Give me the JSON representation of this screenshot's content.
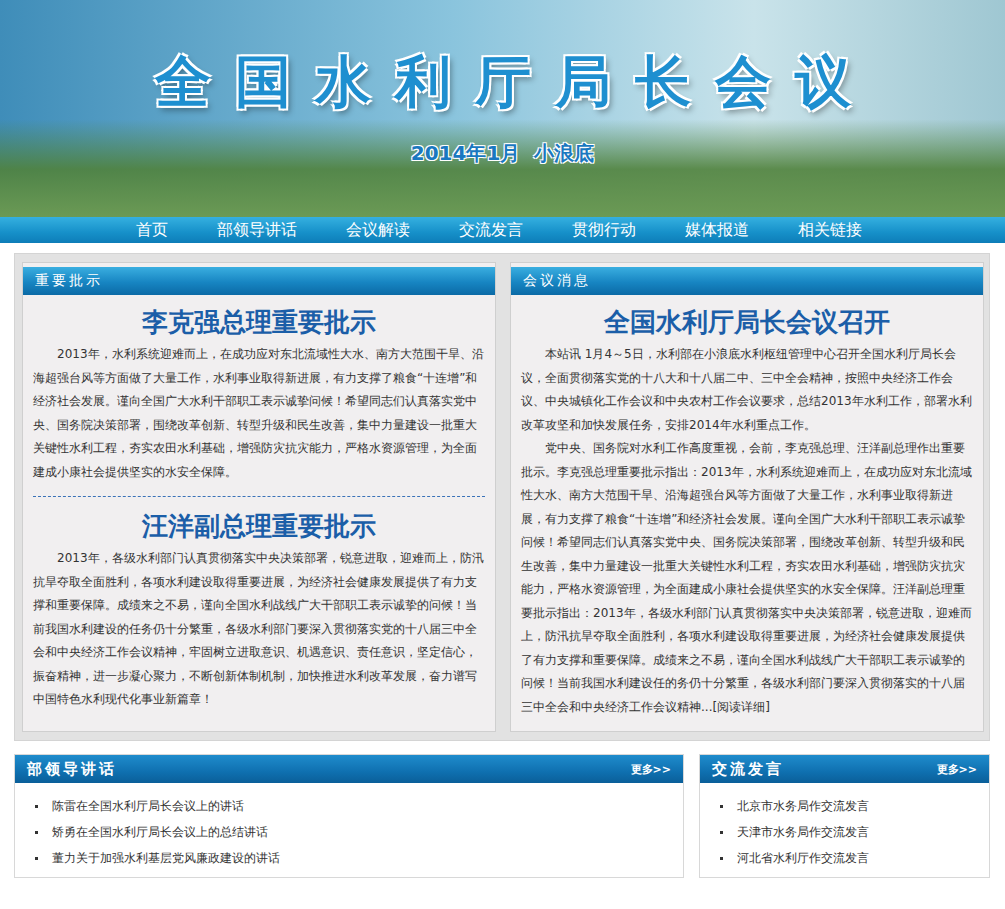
{
  "banner": {
    "title": "全国水利厅局长会议",
    "subtitle": "2014年1月  小浪底"
  },
  "nav": [
    "首页",
    "部领导讲话",
    "会议解读",
    "交流发言",
    "贯彻行动",
    "媒体报道",
    "相关链接"
  ],
  "instructions_panel": {
    "header": "重要批示",
    "items": [
      {
        "title": "李克强总理重要批示",
        "body": "2013年，水利系统迎难而上，在成功应对东北流域性大水、南方大范围干旱、沿海超强台风等方面做了大量工作，水利事业取得新进展，有力支撑了粮食“十连增”和经济社会发展。谨向全国广大水利干部职工表示诚挚问候！希望同志们认真落实党中央、国务院决策部署，围绕改革创新、转型升级和民生改善，集中力量建设一批重大关键性水利工程，夯实农田水利基础，增强防灾抗灾能力，严格水资源管理，为全面建成小康社会提供坚实的水安全保障。"
      },
      {
        "title": "汪洋副总理重要批示",
        "body": "2013年，各级水利部门认真贯彻落实中央决策部署，锐意进取，迎难而上，防汛抗旱夺取全面胜利，各项水利建设取得重要进展，为经济社会健康发展提供了有力支撑和重要保障。成绩来之不易，谨向全国水利战线广大干部职工表示诚挚的问候！当前我国水利建设的任务仍十分繁重，各级水利部门要深入贯彻落实党的十八届三中全会和中央经济工作会议精神，牢固树立进取意识、机遇意识、责任意识，坚定信心，振奋精神，进一步凝心聚力，不断创新体制机制，加快推进水利改革发展，奋力谱写中国特色水利现代化事业新篇章！"
      }
    ]
  },
  "news_panel": {
    "header": "会议消息",
    "title": "全国水利厅局长会议召开",
    "paragraphs": [
      "本站讯  1月4～5日，水利部在小浪底水利枢纽管理中心召开全国水利厅局长会议，全面贯彻落实党的十八大和十八届二中、三中全会精神，按照中央经济工作会议、中央城镇化工作会议和中央农村工作会议要求，总结2013年水利工作，部署水利改革攻坚和加快发展任务，安排2014年水利重点工作。",
      "党中央、国务院对水利工作高度重视，会前，李克强总理、汪洋副总理作出重要批示。李克强总理重要批示指出：2013年，水利系统迎难而上，在成功应对东北流域性大水、南方大范围干旱、沿海超强台风等方面做了大量工作，水利事业取得新进展，有力支撑了粮食“十连增”和经济社会发展。谨向全国广大水利干部职工表示诚挚问候！希望同志们认真落实党中央、国务院决策部署，围绕改革创新、转型升级和民生改善，集中力量建设一批重大关键性水利工程，夯实农田水利基础，增强防灾抗灾能力，严格水资源管理，为全面建成小康社会提供坚实的水安全保障。汪洋副总理重要批示指出：2013年，各级水利部门认真贯彻落实中央决策部署，锐意进取，迎难而上，防汛抗旱夺取全面胜利，各项水利建设取得重要进展，为经济社会健康发展提供了有力支撑和重要保障。成绩来之不易，谨向全国水利战线广大干部职工表示诚挚的问候！当前我国水利建设任的务仍十分繁重，各级水利部门要深入贯彻落实的十八届三中全会和中央经济工作会议精神..."
    ],
    "read_more": "[阅读详细]"
  },
  "speeches_panel": {
    "header": "部领导讲话",
    "more": "更多>>",
    "items": [
      "陈雷在全国水利厅局长会议上的讲话",
      "矫勇在全国水利厅局长会议上的总结讲话",
      "董力关于加强水利基层党风廉政建设的讲话"
    ]
  },
  "exchange_panel": {
    "header": "交流发言",
    "more": "更多>>",
    "items": [
      "北京市水务局作交流发言",
      "天津市水务局作交流发言",
      "河北省水利厅作交流发言"
    ]
  }
}
